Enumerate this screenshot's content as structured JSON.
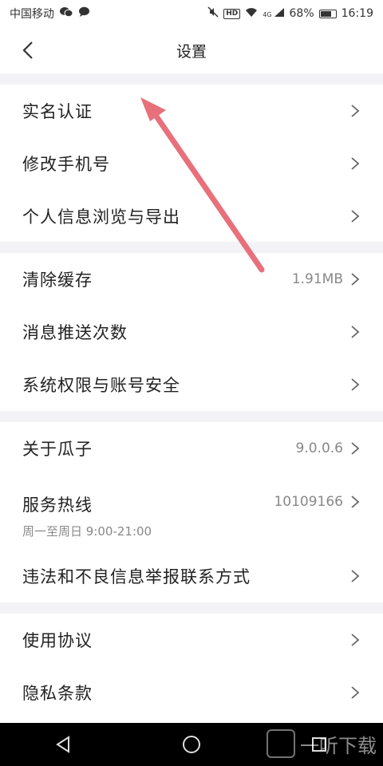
{
  "status_bar": {
    "carrier": "中国移动",
    "network": "4G",
    "hd": "HD",
    "battery_text": "68%",
    "battery_level": 0.68,
    "time": "16:19"
  },
  "header": {
    "title": "设置"
  },
  "rows": {
    "real_name": {
      "label": "实名认证"
    },
    "change_phone": {
      "label": "修改手机号"
    },
    "personal_info": {
      "label": "个人信息浏览与导出"
    },
    "clear_cache": {
      "label": "清除缓存",
      "value": "1.91MB"
    },
    "push_count": {
      "label": "消息推送次数"
    },
    "permissions": {
      "label": "系统权限与账号安全"
    },
    "about": {
      "label": "关于瓜子",
      "value": "9.0.0.6"
    },
    "hotline": {
      "label": "服务热线",
      "value": "10109166",
      "sub": "周一至周日 9:00-21:00"
    },
    "report": {
      "label": "违法和不良信息举报联系方式"
    },
    "agreement": {
      "label": "使用协议"
    },
    "privacy": {
      "label": "隐私条款"
    }
  },
  "watermark": {
    "text": "一听下载"
  },
  "colors": {
    "gap": "#f3f3f7",
    "annotation_arrow": "#e8707a",
    "nav": "#000000"
  }
}
